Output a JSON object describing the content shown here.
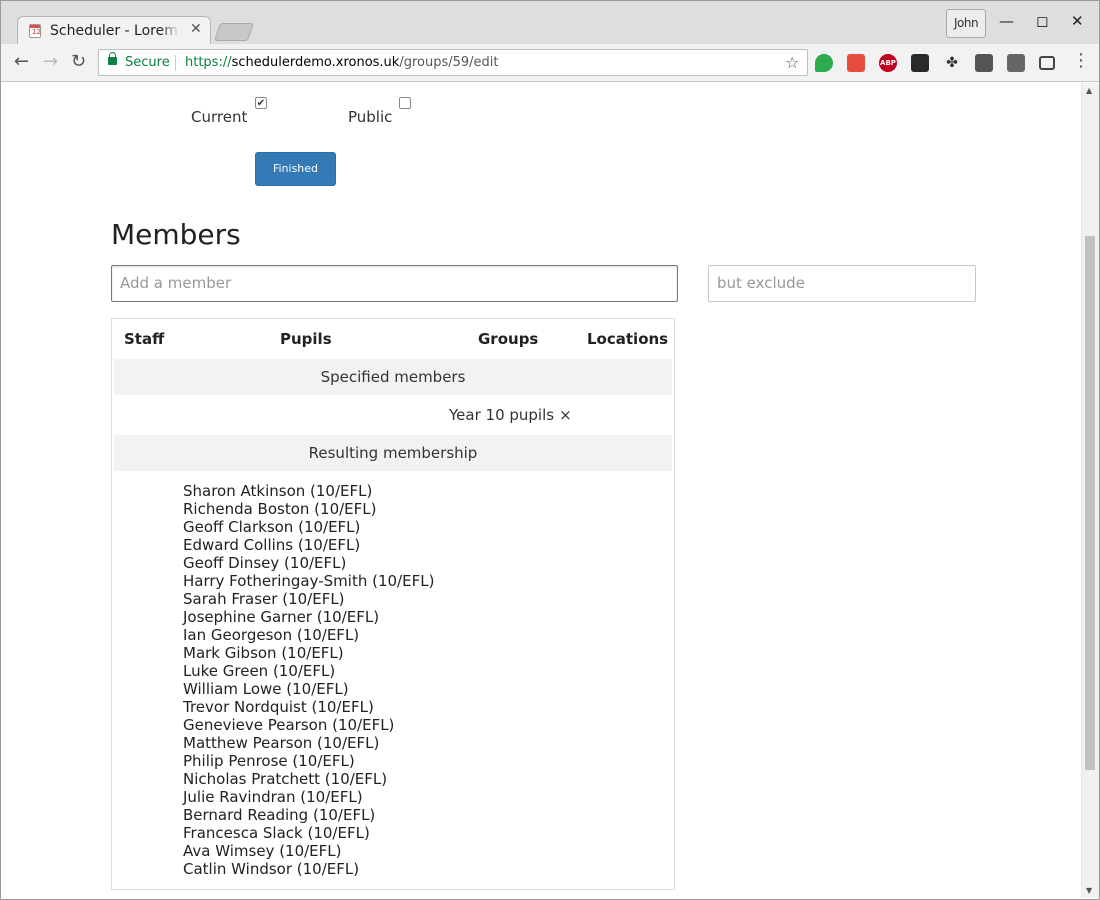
{
  "browser": {
    "tab_title": "Scheduler - Lorem Ipsum",
    "profile_name": "John",
    "secure_label": "Secure",
    "url_protocol": "https://",
    "url_host": "schedulerdemo.xronos.uk",
    "url_path": "/groups/59/edit"
  },
  "form": {
    "current_label": "Current",
    "current_checked": true,
    "public_label": "Public",
    "public_checked": false,
    "finished_label": "Finished"
  },
  "members": {
    "heading": "Members",
    "add_placeholder": "Add a member",
    "exclude_placeholder": "but exclude",
    "columns": [
      "Staff",
      "Pupils",
      "Groups",
      "Locations"
    ],
    "specified_heading": "Specified members",
    "specified_items": [
      {
        "label": "Year 10 pupils",
        "remove": "×"
      }
    ],
    "resulting_heading": "Resulting membership",
    "resulting": [
      "Sharon Atkinson (10/EFL)",
      "Richenda Boston (10/EFL)",
      "Geoff Clarkson (10/EFL)",
      "Edward Collins (10/EFL)",
      "Geoff Dinsey (10/EFL)",
      "Harry Fotheringay-Smith (10/EFL)",
      "Sarah Fraser (10/EFL)",
      "Josephine Garner (10/EFL)",
      "Ian Georgeson (10/EFL)",
      "Mark Gibson (10/EFL)",
      "Luke Green (10/EFL)",
      "William Lowe (10/EFL)",
      "Trevor Nordquist (10/EFL)",
      "Genevieve Pearson (10/EFL)",
      "Matthew Pearson (10/EFL)",
      "Philip Penrose (10/EFL)",
      "Nicholas Pratchett (10/EFL)",
      "Julie Ravindran (10/EFL)",
      "Bernard Reading (10/EFL)",
      "Francesca Slack (10/EFL)",
      "Ava Wimsey (10/EFL)",
      "Catlin Windsor (10/EFL)"
    ]
  },
  "colors": {
    "primary_button": "#337ab7",
    "secure_green": "#0b8043"
  }
}
